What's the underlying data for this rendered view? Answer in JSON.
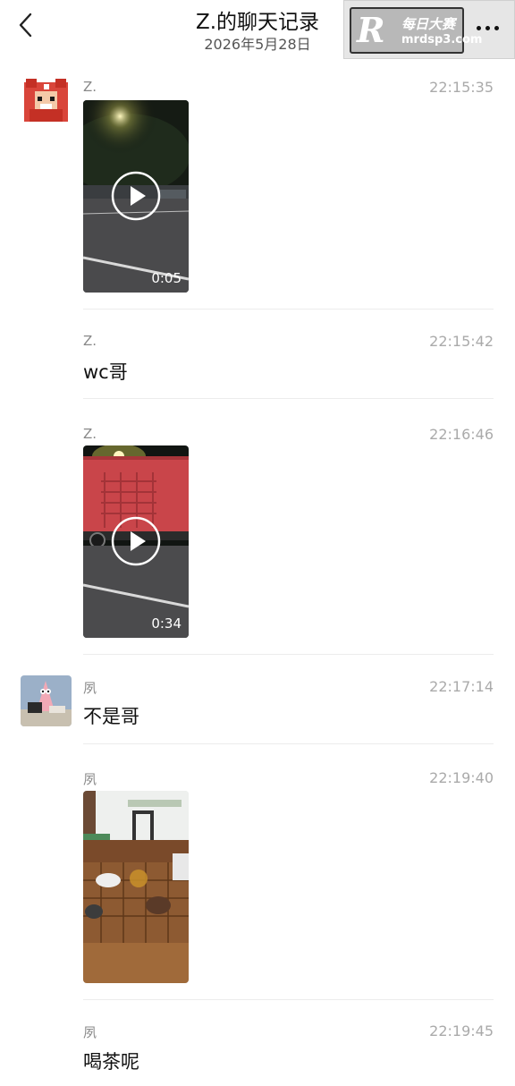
{
  "header": {
    "title": "Z.的聊天记录",
    "date": "2026年5月28日",
    "watermark_cn": "每日大赛",
    "watermark_url": "mrdsp3.com"
  },
  "messages": [
    {
      "sender": "Z.",
      "time": "22:15:35",
      "type": "video",
      "duration": "0:05"
    },
    {
      "sender": "Z.",
      "time": "22:15:42",
      "type": "text",
      "text": "wc哥"
    },
    {
      "sender": "Z.",
      "time": "22:16:46",
      "type": "video",
      "duration": "0:34"
    },
    {
      "sender": "夙",
      "time": "22:17:14",
      "type": "text",
      "text": "不是哥"
    },
    {
      "sender": "夙",
      "time": "22:19:40",
      "type": "image"
    },
    {
      "sender": "夙",
      "time": "22:19:45",
      "type": "text",
      "text": "喝茶呢"
    }
  ]
}
